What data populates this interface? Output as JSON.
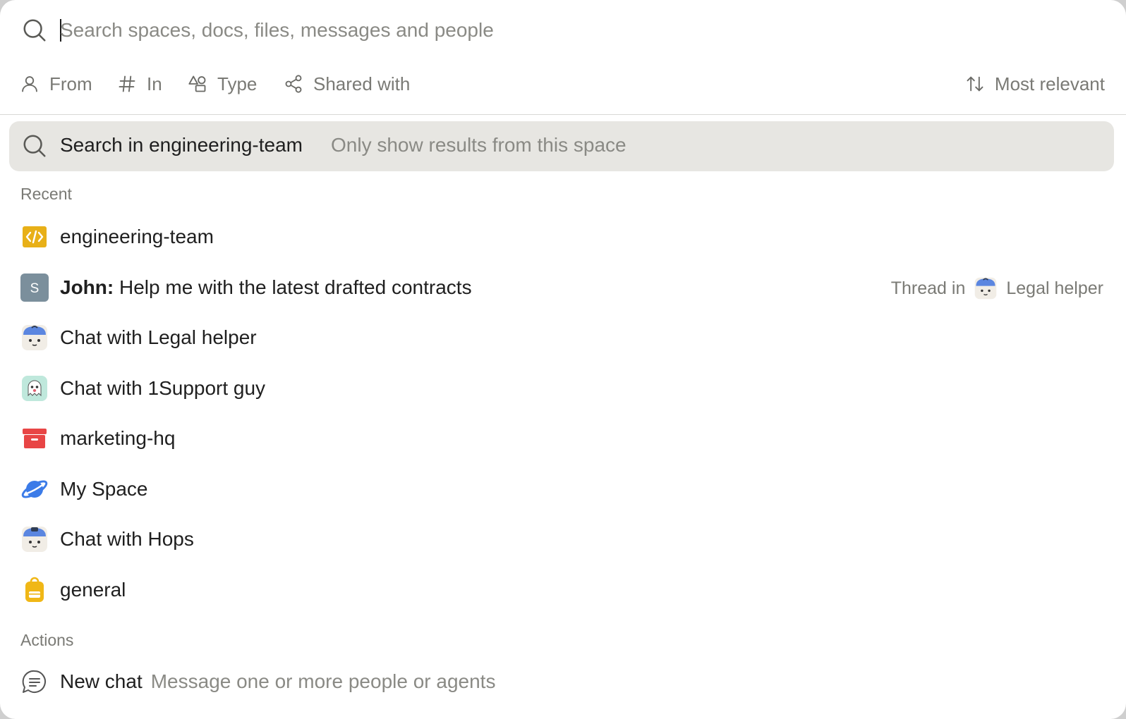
{
  "search": {
    "placeholder": "Search spaces, docs, files, messages and people",
    "value": ""
  },
  "filters": {
    "from": "From",
    "in": "In",
    "type": "Type",
    "shared_with": "Shared with",
    "sort": "Most relevant"
  },
  "scope": {
    "label": "Search in engineering-team",
    "hint": "Only show results from this space"
  },
  "recent": {
    "heading": "Recent",
    "items": [
      {
        "label": "engineering-team",
        "icon": "code-icon"
      },
      {
        "author": "John:",
        "label": "Help me with the latest drafted contracts",
        "avatar_letter": "S",
        "meta_prefix": "Thread in",
        "meta_target": "Legal helper"
      },
      {
        "label": "Chat with Legal helper",
        "icon": "legal-helper-avatar"
      },
      {
        "label": "Chat with 1Support guy",
        "icon": "ghost-avatar"
      },
      {
        "label": "marketing-hq",
        "icon": "archive-box-icon"
      },
      {
        "label": "My Space",
        "icon": "planet-icon"
      },
      {
        "label": "Chat with Hops",
        "icon": "hops-avatar"
      },
      {
        "label": "general",
        "icon": "backpack-icon"
      }
    ]
  },
  "actions": {
    "heading": "Actions",
    "items": [
      {
        "label": "New chat",
        "hint": "Message one or more people or agents",
        "icon": "chat-bubble-icon"
      }
    ]
  },
  "colors": {
    "scope_bg": "#e7e6e2",
    "code_icon": "#e8b018",
    "avatar_s": "#7b8f9c",
    "archive_icon": "#e84545",
    "planet_icon": "#3b7be8",
    "backpack_icon": "#f0b716"
  }
}
